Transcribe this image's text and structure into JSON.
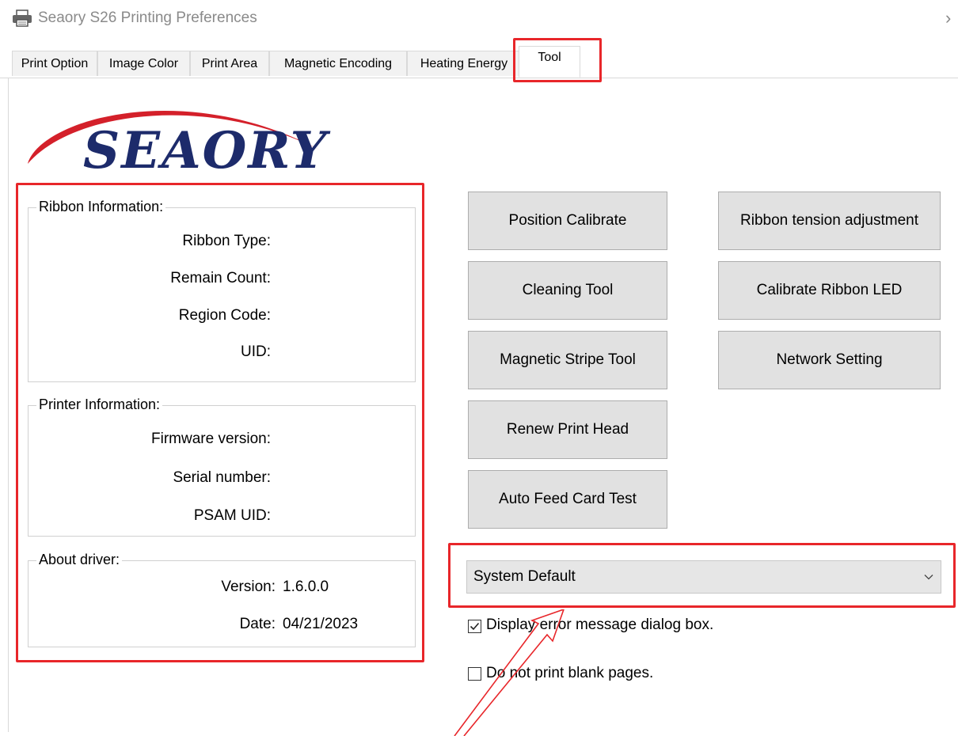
{
  "window": {
    "title": "Seaory S26 Printing Preferences",
    "close_glyph": "›"
  },
  "tabs": [
    {
      "label": "Print Option"
    },
    {
      "label": "Image Color"
    },
    {
      "label": "Print Area"
    },
    {
      "label": "Magnetic Encoding"
    },
    {
      "label": "Heating Energy"
    },
    {
      "label": "Tool",
      "active": true
    }
  ],
  "logo": {
    "text": "SEAORY"
  },
  "ribbon_info": {
    "title": "Ribbon Information:",
    "ribbon_type_label": "Ribbon Type:",
    "remain_count_label": "Remain Count:",
    "region_code_label": "Region Code:",
    "uid_label": "UID:"
  },
  "printer_info": {
    "title": "Printer Information:",
    "firmware_label": "Firmware version:",
    "serial_label": "Serial number:",
    "psam_label": "PSAM UID:"
  },
  "about_driver": {
    "title": "About driver:",
    "version_label": "Version:",
    "version_value": "1.6.0.0",
    "date_label": "Date:",
    "date_value": "04/21/2023"
  },
  "buttons": {
    "position_calibrate": "Position Calibrate",
    "ribbon_tension": "Ribbon tension adjustment",
    "cleaning_tool": "Cleaning Tool",
    "calibrate_ribbon_led": "Calibrate Ribbon LED",
    "magnetic_stripe_tool": "Magnetic Stripe Tool",
    "network_setting": "Network Setting",
    "renew_print_head": "Renew Print Head",
    "auto_feed_card_test": "Auto Feed Card Test"
  },
  "language_select": {
    "value": "System Default"
  },
  "options": {
    "display_error": {
      "label": "Display error message dialog box.",
      "checked": true
    },
    "no_blank_pages": {
      "label": "Do not print blank pages.",
      "checked": false
    }
  },
  "colors": {
    "annotation_red": "#e8262a",
    "logo_navy": "#1d2b6b",
    "logo_red": "#d4202a",
    "button_face": "#e1e1e1"
  },
  "icons": {
    "app": "printer-icon",
    "close": "chevron-right-icon",
    "select": "chevron-down-icon",
    "check": "check-icon"
  }
}
